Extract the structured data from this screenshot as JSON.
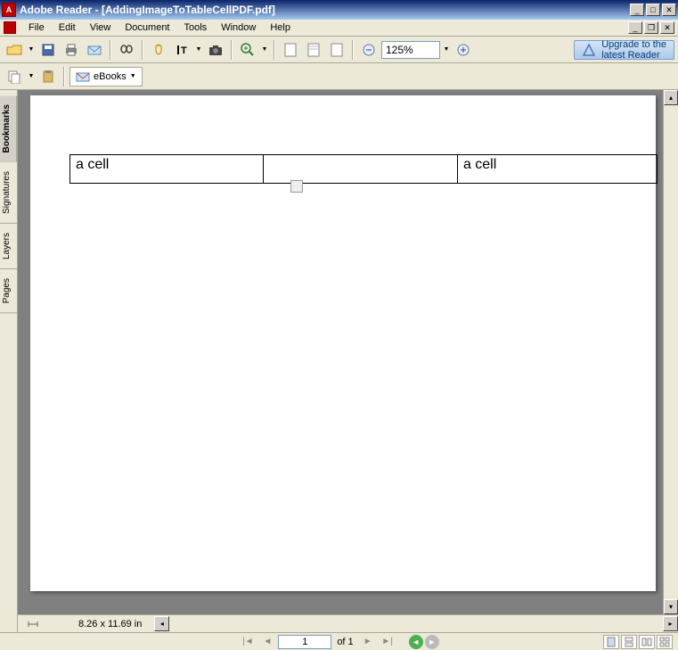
{
  "titlebar": {
    "title": "Adobe Reader - [AddingImageToTableCellPDF.pdf]"
  },
  "menu": {
    "file": "File",
    "edit": "Edit",
    "view": "View",
    "document": "Document",
    "tools": "Tools",
    "window": "Window",
    "help": "Help"
  },
  "toolbar": {
    "zoom_value": "125%",
    "upgrade_line1": "Upgrade to the",
    "upgrade_line2": "latest Reader",
    "ebooks": "eBooks"
  },
  "sidetabs": {
    "bookmarks": "Bookmarks",
    "signatures": "Signatures",
    "layers": "Layers",
    "pages": "Pages"
  },
  "page": {
    "cell_a": "a cell",
    "cell_c": "a cell"
  },
  "status": {
    "dims": "8.26 x 11.69 in"
  },
  "nav": {
    "page_input": "1",
    "of": "of 1"
  }
}
